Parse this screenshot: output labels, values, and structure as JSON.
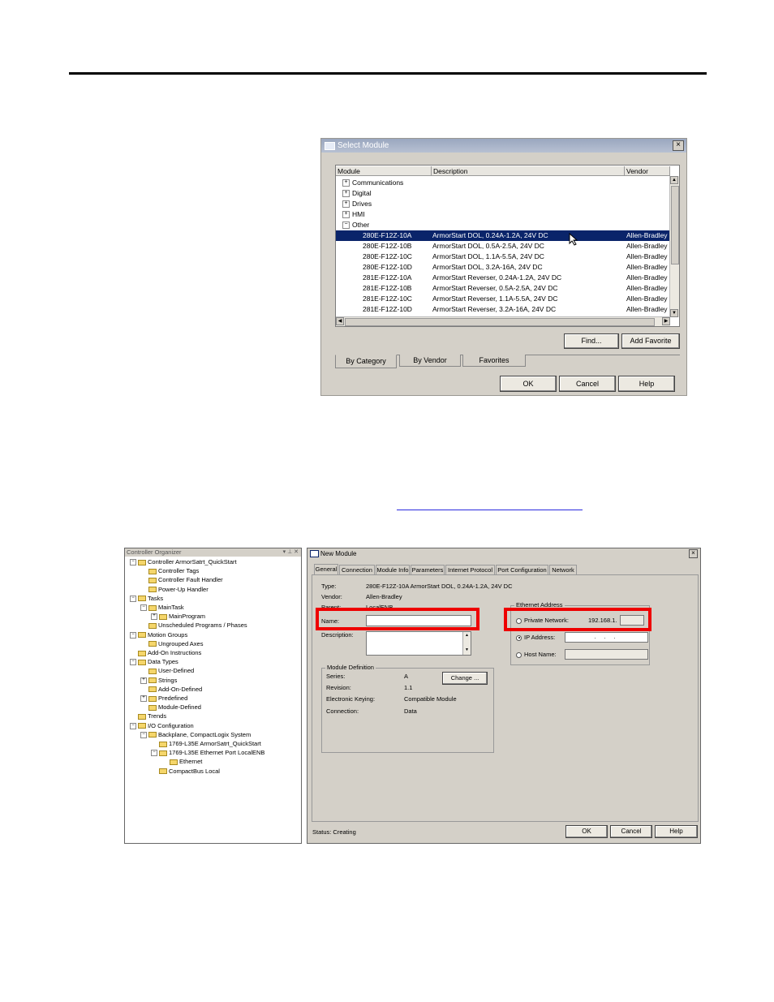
{
  "select_module": {
    "title": "Select Module",
    "columns": [
      "Module",
      "Description",
      "Vendor"
    ],
    "categories": [
      "Communications",
      "Digital",
      "Drives",
      "HMI",
      "Other"
    ],
    "rows": [
      {
        "module": "280E-F12Z-10A",
        "description": "ArmorStart DOL, 0.24A-1.2A, 24V DC",
        "vendor": "Allen-Bradley",
        "selected": true
      },
      {
        "module": "280E-F12Z-10B",
        "description": "ArmorStart DOL, 0.5A-2.5A, 24V DC",
        "vendor": "Allen-Bradley"
      },
      {
        "module": "280E-F12Z-10C",
        "description": "ArmorStart DOL, 1.1A-5.5A, 24V DC",
        "vendor": "Allen-Bradley"
      },
      {
        "module": "280E-F12Z-10D",
        "description": "ArmorStart DOL, 3.2A-16A, 24V DC",
        "vendor": "Allen-Bradley"
      },
      {
        "module": "281E-F12Z-10A",
        "description": "ArmorStart Reverser, 0.24A-1.2A, 24V DC",
        "vendor": "Allen-Bradley"
      },
      {
        "module": "281E-F12Z-10B",
        "description": "ArmorStart Reverser, 0.5A-2.5A, 24V DC",
        "vendor": "Allen-Bradley"
      },
      {
        "module": "281E-F12Z-10C",
        "description": "ArmorStart Reverser, 1.1A-5.5A, 24V DC",
        "vendor": "Allen-Bradley"
      },
      {
        "module": "281E-F12Z-10D",
        "description": "ArmorStart Reverser, 3.2A-16A, 24V DC",
        "vendor": "Allen-Bradley"
      }
    ],
    "find_label": "Find...",
    "add_favorite_label": "Add Favorite",
    "tabs": [
      "By Category",
      "By Vendor",
      "Favorites"
    ],
    "ok_label": "OK",
    "cancel_label": "Cancel",
    "help_label": "Help"
  },
  "organizer": {
    "title": "Controller Organizer",
    "title_controls": "▾ % ✕",
    "nodes": [
      {
        "text": "Controller ArmorSatrt_QuickStart",
        "depth": 0,
        "exp": "-"
      },
      {
        "text": "Controller Tags",
        "depth": 1,
        "exp": ""
      },
      {
        "text": "Controller Fault Handler",
        "depth": 1,
        "exp": ""
      },
      {
        "text": "Power-Up Handler",
        "depth": 1,
        "exp": ""
      },
      {
        "text": "Tasks",
        "depth": 0,
        "exp": "-"
      },
      {
        "text": "MainTask",
        "depth": 1,
        "exp": "-"
      },
      {
        "text": "MainProgram",
        "depth": 2,
        "exp": "+"
      },
      {
        "text": "Unscheduled Programs / Phases",
        "depth": 1,
        "exp": ""
      },
      {
        "text": "Motion Groups",
        "depth": 0,
        "exp": "-"
      },
      {
        "text": "Ungrouped Axes",
        "depth": 1,
        "exp": ""
      },
      {
        "text": "Add-On Instructions",
        "depth": 0,
        "exp": ""
      },
      {
        "text": "Data Types",
        "depth": 0,
        "exp": "-"
      },
      {
        "text": "User-Defined",
        "depth": 1,
        "exp": ""
      },
      {
        "text": "Strings",
        "depth": 1,
        "exp": "+"
      },
      {
        "text": "Add-On-Defined",
        "depth": 1,
        "exp": ""
      },
      {
        "text": "Predefined",
        "depth": 1,
        "exp": "+"
      },
      {
        "text": "Module-Defined",
        "depth": 1,
        "exp": ""
      },
      {
        "text": "Trends",
        "depth": 0,
        "exp": ""
      },
      {
        "text": "I/O Configuration",
        "depth": 0,
        "exp": "-"
      },
      {
        "text": "Backplane, CompactLogix System",
        "depth": 1,
        "exp": "-"
      },
      {
        "text": "1769-L35E ArmorSatrt_QuickStart",
        "depth": 2,
        "exp": ""
      },
      {
        "text": "1769-L35E Ethernet Port LocalENB",
        "depth": 2,
        "exp": "-"
      },
      {
        "text": "Ethernet",
        "depth": 3,
        "exp": ""
      },
      {
        "text": "CompactBus Local",
        "depth": 2,
        "exp": ""
      }
    ]
  },
  "new_module": {
    "title": "New Module",
    "tabs": [
      "General",
      "Connection",
      "Module Info",
      "Parameters",
      "Internet Protocol",
      "Port Configuration",
      "Network"
    ],
    "type_label": "Type:",
    "type_value": "280E-F12Z-10A ArmorStart DOL, 0.24A-1.2A, 24V DC",
    "vendor_label": "Vendor:",
    "vendor_value": "Allen-Bradley",
    "parent_label": "Parent:",
    "parent_value": "LocalENB",
    "name_label": "Name:",
    "name_value": "",
    "description_label": "Description:",
    "module_definition": {
      "title": "Module Definition",
      "series_label": "Series:",
      "series_value": "A",
      "revision_label": "Revision:",
      "revision_value": "1.1",
      "keying_label": "Electronic Keying:",
      "keying_value": "Compatible Module",
      "connection_label": "Connection:",
      "connection_value": "Data",
      "change_label": "Change ..."
    },
    "ethernet": {
      "title": "Ethernet Address",
      "private_label": "Private Network:",
      "private_value": "192.168.1.",
      "ip_label": "IP Address:",
      "ip_value": ".   .   .",
      "host_label": "Host Name:"
    },
    "status": "Status:  Creating",
    "ok_label": "OK",
    "cancel_label": "Cancel",
    "help_label": "Help"
  }
}
